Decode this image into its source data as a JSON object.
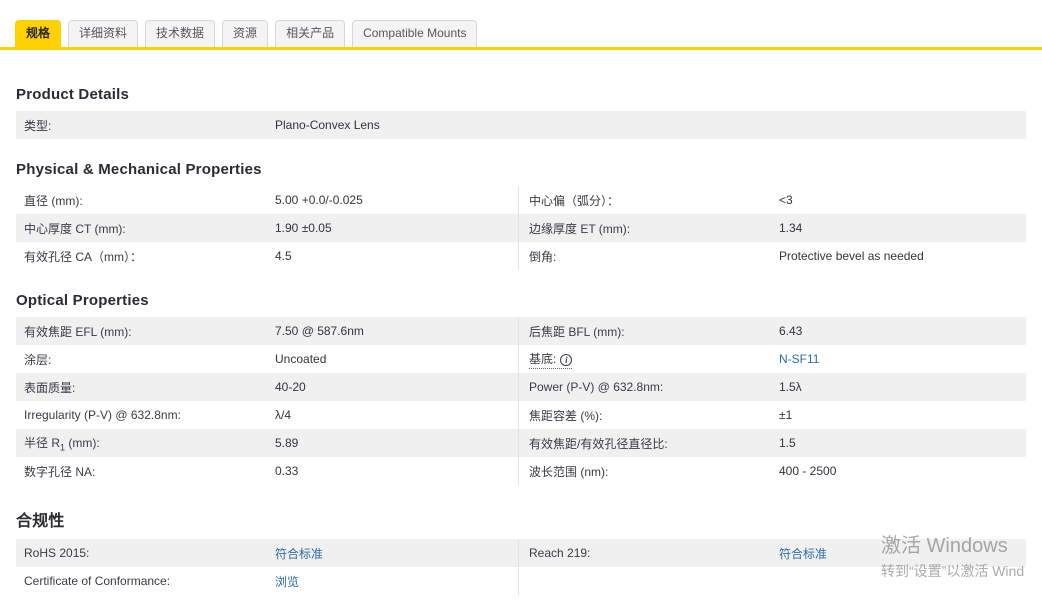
{
  "colors": {
    "accent_yellow": "#ffd100",
    "link_blue": "#2d6ca2",
    "row_shade_gray": "#f0f0f0",
    "text_dark": "#33333c"
  },
  "tabs": [
    {
      "name": "specifications",
      "label": "规格",
      "active": true
    },
    {
      "name": "details",
      "label": "详细资料",
      "active": false
    },
    {
      "name": "technical-data",
      "label": "技术数据",
      "active": false
    },
    {
      "name": "resources",
      "label": "资源",
      "active": false
    },
    {
      "name": "related-products",
      "label": "相关产品",
      "active": false
    },
    {
      "name": "compatible-mounts",
      "label": "Compatible Mounts",
      "active": false
    }
  ],
  "sections": [
    {
      "title": "Product Details",
      "name": "product-details",
      "layout": "single",
      "rows": [
        {
          "left": {
            "label": "类型:",
            "value": "Plano-Convex Lens"
          }
        }
      ]
    },
    {
      "title": "Physical & Mechanical Properties",
      "name": "physical-mechanical-properties",
      "layout": "double",
      "rows": [
        {
          "left": {
            "label": "直径 (mm):",
            "value": "5.00 +0.0/-0.025"
          },
          "right": {
            "label": "中心偏（弧分）：",
            "value": "<3"
          }
        },
        {
          "left": {
            "label": "中心厚度 CT (mm):",
            "value": "1.90 ±0.05"
          },
          "right": {
            "label": "边缘厚度 ET (mm):",
            "value": "1.34"
          }
        },
        {
          "left": {
            "label": "有效孔径 CA（mm）：",
            "value": "4.5"
          },
          "right": {
            "label": "倒角:",
            "value": "Protective bevel as needed"
          }
        }
      ]
    },
    {
      "title": "Optical Properties",
      "name": "optical-properties",
      "layout": "double",
      "rows": [
        {
          "left": {
            "label": "有效焦距 EFL (mm):",
            "value": "7.50 @ 587.6nm"
          },
          "right": {
            "label": "后焦距 BFL (mm):",
            "value": "6.43"
          }
        },
        {
          "left": {
            "label": "涂层:",
            "value": "Uncoated"
          },
          "right": {
            "label": "基底:",
            "info": true,
            "value": "N-SF11",
            "link": true
          }
        },
        {
          "left": {
            "label": "表面质量:",
            "value": "40-20"
          },
          "right": {
            "label": "Power (P-V) @ 632.8nm:",
            "value": "1.5λ"
          }
        },
        {
          "left": {
            "label": "Irregularity (P-V) @ 632.8nm:",
            "value": "λ/4"
          },
          "right": {
            "label": "焦距容差 (%):",
            "value": "±1"
          }
        },
        {
          "left": {
            "label": "半径 R",
            "sub": "1",
            "label_end": " (mm):",
            "value": "5.89"
          },
          "right": {
            "label": "有效焦距/有效孔径直径比:",
            "value": "1.5"
          }
        },
        {
          "left": {
            "label": "数字孔径 NA:",
            "value": "0.33"
          },
          "right": {
            "label": "波长范围 (nm):",
            "value": "400 - 2500"
          }
        }
      ]
    },
    {
      "title": "合规性",
      "name": "compliance",
      "layout": "double",
      "cjk_title": true,
      "rows": [
        {
          "left": {
            "label": "RoHS 2015:",
            "value": "符合标准",
            "link": true
          },
          "right": {
            "label": "Reach 219:",
            "value": "符合标准",
            "link": true
          }
        },
        {
          "left": {
            "label": "Certificate of Conformance:",
            "value": "浏览",
            "link": true
          },
          "right": null
        }
      ]
    }
  ],
  "watermark": {
    "line1": "激活 Windows",
    "line2": "转到“设置”以激活 Wind"
  }
}
